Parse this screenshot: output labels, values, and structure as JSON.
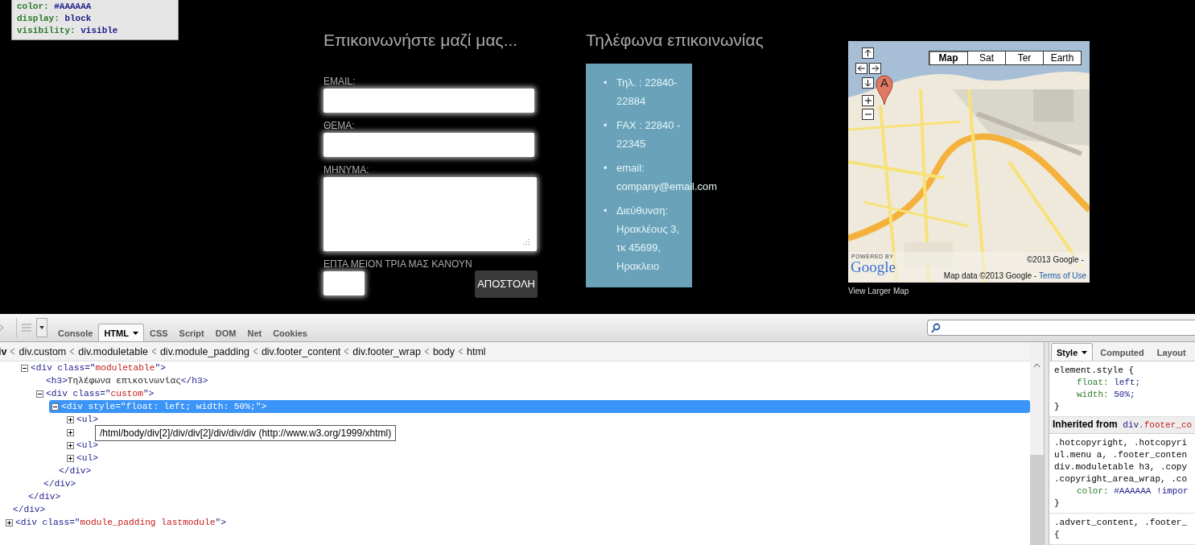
{
  "style_tooltip": {
    "lines": [
      {
        "property": "color:",
        "value": "#AAAAAA"
      },
      {
        "property": "display:",
        "value": "block"
      },
      {
        "property": "visibility:",
        "value": "visible"
      }
    ]
  },
  "contact_form": {
    "title": "Επικοινωνήστε μαζί μας...",
    "fields": [
      {
        "label": "EMAIL:",
        "kind": "input"
      },
      {
        "label": "ΘΕΜΑ:",
        "kind": "input"
      },
      {
        "label": "ΜΗΝΥΜΑ:",
        "kind": "textarea"
      },
      {
        "label": "ΕΠΤΑ ΜΕΙΟΝ ΤΡΙΑ ΜΑΣ ΚΑΝΟΥΝ",
        "kind": "captcha"
      }
    ],
    "submit_button": "ΑΠΟΣΤΟΛΗ"
  },
  "phones": {
    "title": "Τηλέφωνα επικοινωνίας",
    "bullet": "•",
    "items": [
      {
        "text": "Τηλ. : 22840-22884"
      },
      {
        "text": "FAX : 22840 - 22345"
      },
      {
        "text": "email:",
        "link": "company@email.com"
      },
      {
        "text": "Διεύθυνση: Ηρακλέους 3, τκ 45699, Ηρακλειο"
      }
    ]
  },
  "map": {
    "type_buttons": [
      {
        "label": "Map",
        "selected": true
      },
      {
        "label": "Sat",
        "selected": false
      },
      {
        "label": "Ter",
        "selected": false
      },
      {
        "label": "Earth",
        "selected": false
      }
    ],
    "marker": "A",
    "powered_by": "POWERED BY",
    "logo": "Google",
    "copyright": "©2013 Google -",
    "attribution": "Map data ©2013 Google -",
    "terms_link": "Terms of Use",
    "view_larger": "View Larger Map"
  },
  "devtools": {
    "tabs": [
      {
        "label": "Console",
        "selected": false,
        "menu": false
      },
      {
        "label": "HTML",
        "selected": true,
        "menu": true
      },
      {
        "label": "CSS",
        "selected": false,
        "menu": false
      },
      {
        "label": "Script",
        "selected": false,
        "menu": false
      },
      {
        "label": "DOM",
        "selected": false,
        "menu": false
      },
      {
        "label": "Net",
        "selected": false,
        "menu": false
      },
      {
        "label": "Cookies",
        "selected": false,
        "menu": false
      }
    ],
    "breadcrumb": [
      "iv",
      "div.custom",
      "div.moduletable",
      "div.module_padding",
      "div.footer_content",
      "div.footer_wrap",
      "body",
      "html"
    ],
    "tree": [
      {
        "close": "</div>",
        "children": [
          {
            "expanded": true,
            "selected": false,
            "segments": [
              {
                "kind": "tag",
                "text": "<div class=\""
              },
              {
                "kind": "value",
                "text": "moduletable"
              },
              {
                "kind": "tag",
                "text": "\">"
              }
            ],
            "close": "</div>",
            "children": [
              {
                "selected": false,
                "segments": [
                  {
                    "kind": "tag",
                    "text": "<h3>"
                  },
                  {
                    "kind": "text",
                    "text": "Τηλέφωνα επικοινωνίας"
                  },
                  {
                    "kind": "tag",
                    "text": "</h3>"
                  }
                ]
              },
              {
                "expanded": true,
                "selected": false,
                "segments": [
                  {
                    "kind": "tag",
                    "text": "<div class=\""
                  },
                  {
                    "kind": "value",
                    "text": "custom"
                  },
                  {
                    "kind": "tag",
                    "text": "\">"
                  }
                ],
                "close": "</div>",
                "children": [
                  {
                    "expanded": true,
                    "selected": true,
                    "segments": [
                      {
                        "kind": "tag",
                        "text": "<div style=\"float: left; width: 50%;\">"
                      }
                    ],
                    "close": "</div>",
                    "children": [
                      {
                        "expanded": false,
                        "selected": false,
                        "segments": [
                          {
                            "kind": "tag",
                            "text": "<ul>"
                          }
                        ]
                      },
                      {
                        "expanded": false,
                        "selected": false
                      },
                      {
                        "expanded": false,
                        "selected": false,
                        "segments": [
                          {
                            "kind": "tag",
                            "text": "<ul>"
                          }
                        ]
                      },
                      {
                        "expanded": false,
                        "selected": false,
                        "segments": [
                          {
                            "kind": "tag",
                            "text": "<ul>"
                          }
                        ]
                      }
                    ]
                  }
                ]
              }
            ]
          }
        ]
      },
      {
        "expanded": false,
        "selected": false,
        "segments": [
          {
            "kind": "tag",
            "text": "<div class=\""
          },
          {
            "kind": "value",
            "text": "module_padding lastmodule"
          },
          {
            "kind": "tag",
            "text": "\">"
          }
        ]
      }
    ],
    "path_tooltip": "/html/body/div[2]/div/div[2]/div/div/div (http://www.w3.org/1999/xhtml)",
    "side_tabs": [
      {
        "label": "Style",
        "selected": true,
        "menu": true
      },
      {
        "label": "Computed",
        "selected": false,
        "menu": false
      },
      {
        "label": "Layout",
        "selected": false,
        "menu": false
      }
    ],
    "rules": [
      {
        "selectors": [
          "element.style {"
        ],
        "declarations": [
          {
            "property": "float:",
            "value": "left;"
          },
          {
            "property": "width:",
            "value": "50%;"
          }
        ],
        "close": "}"
      },
      {
        "inherited": {
          "label": "Inherited from",
          "element": "div",
          "class": ".footer_co"
        }
      },
      {
        "selectors": [
          ".hotcopyright, .hotcopyri",
          "ul.menu a, .footer_conten",
          "div.moduletable h3, .copy",
          ".copyright_area_wrap, .co"
        ],
        "declarations": [
          {
            "property": "color:",
            "value": "#AAAAAA !impor"
          }
        ],
        "close": "}"
      },
      {
        "selectors": [
          ".advert_content, .footer_",
          "{"
        ]
      }
    ]
  }
}
